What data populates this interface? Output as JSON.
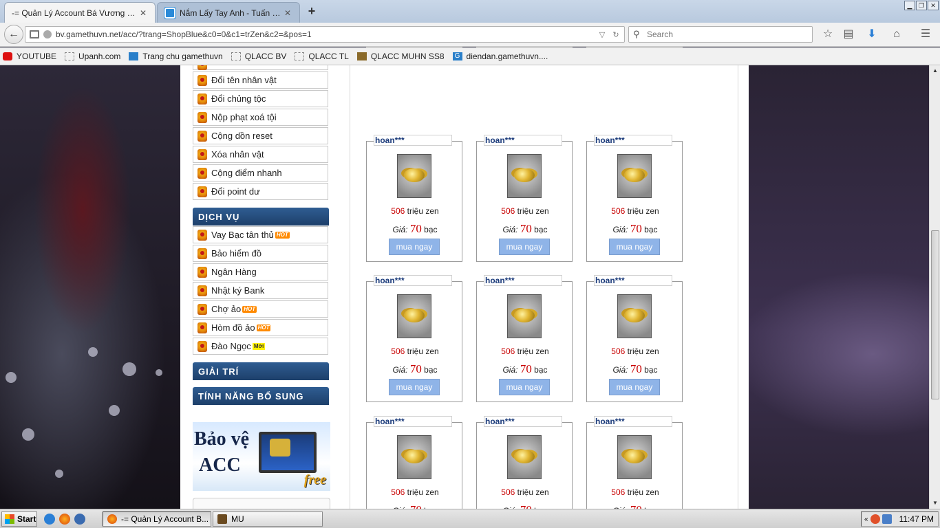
{
  "browser": {
    "tabs": [
      {
        "title": "-= Quản Lý Account Bá Vương =- ..."
      },
      {
        "title": "Nắm Lấy Tay Anh - Tuấn Hưn..."
      }
    ],
    "url": "bv.gamethuvn.net/acc/?trang=ShopBlue&c0=0&c1=trZen&c2=&pos=1",
    "search_placeholder": "Search",
    "bookmarks": [
      {
        "label": "YOUTUBE",
        "icon": "youtube-icon"
      },
      {
        "label": "Upanh.com",
        "icon": "page-icon"
      },
      {
        "label": "Trang chu gamethuvn",
        "icon": "gamethuvn-icon"
      },
      {
        "label": "QLACC BV",
        "icon": "page-icon"
      },
      {
        "label": "QLACC TL",
        "icon": "page-icon"
      },
      {
        "label": "QLACC MUHN SS8",
        "icon": "mu-icon"
      },
      {
        "label": "diendan.gamethuvn....",
        "icon": "g-icon"
      }
    ]
  },
  "sidebar": {
    "menu_top": [
      {
        "label": "Đổi tên nhân vật"
      },
      {
        "label": "Đổi chủng tộc"
      },
      {
        "label": "Nộp phạt xoá tội"
      },
      {
        "label": "Cộng dồn reset"
      },
      {
        "label": "Xóa nhân vật"
      },
      {
        "label": "Cộng điểm nhanh"
      },
      {
        "label": "Đổi point dư"
      }
    ],
    "section_dichvu": "DỊCH VỤ",
    "menu_dichvu": [
      {
        "label": "Vay Bạc tân thủ",
        "badge": "HOT"
      },
      {
        "label": "Bảo hiểm đồ",
        "badge": ""
      },
      {
        "label": "Ngân Hàng",
        "badge": ""
      },
      {
        "label": "Nhật ký Bank",
        "badge": ""
      },
      {
        "label": "Chợ ảo",
        "badge": "HOT"
      },
      {
        "label": "Hòm đồ ảo",
        "badge": "HOT"
      },
      {
        "label": "Đào Ngọc",
        "badge": "Mới"
      }
    ],
    "section_giaitri": "GIẢI TRÍ",
    "section_tinhnang": "TÍNH NĂNG BỔ SUNG",
    "promo": {
      "line1": "Bảo vệ",
      "line2": "ACC",
      "free": "free"
    }
  },
  "shop": {
    "seller_name": "hoan***",
    "amount_num": "506",
    "amount_unit": "triệu zen",
    "price_label": "Giá:",
    "price_value": "70",
    "price_unit": "bạc",
    "buy_label": "mua ngay"
  },
  "taskbar": {
    "start_label": "Start",
    "tasks": [
      {
        "label": "-= Quản Lý Account B..."
      },
      {
        "label": "MU"
      }
    ],
    "clock": "11:47 PM"
  },
  "colors": {
    "accent_blue": "#1d3f6a",
    "price_red": "#c80000",
    "buy_button": "#8fb4e8"
  }
}
